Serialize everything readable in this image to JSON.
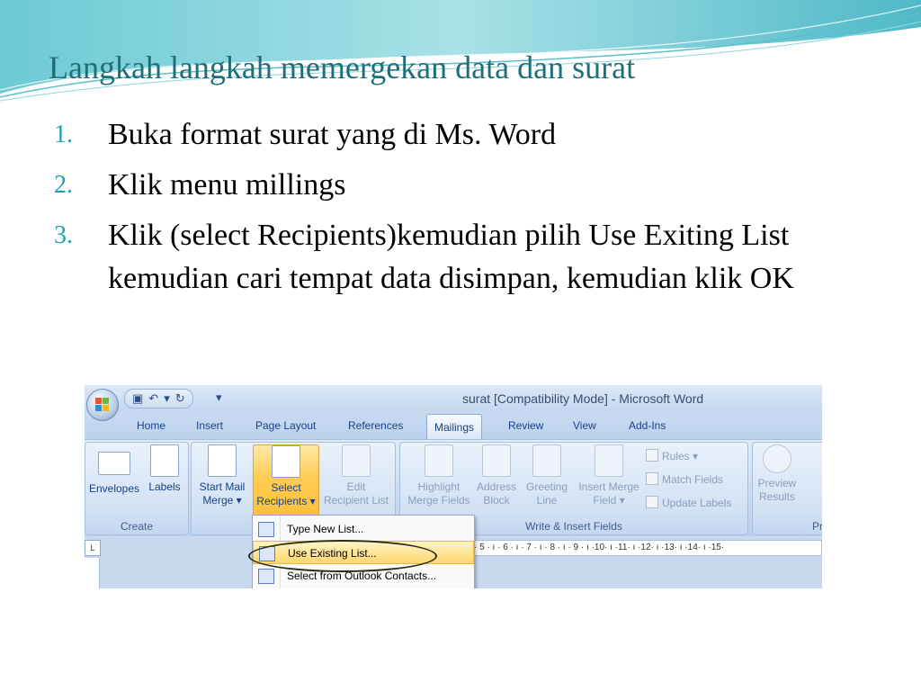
{
  "slide": {
    "title": "Langkah langkah memergekan data dan surat",
    "steps": [
      {
        "num": "1.",
        "text": "Buka format surat yang di Ms. Word"
      },
      {
        "num": "2.",
        "text": "Klik menu millings"
      },
      {
        "num": "3.",
        "text": "Klik (select Recipients)kemudian pilih Use Exiting List kemudian cari tempat data disimpan, kemudian klik OK"
      }
    ]
  },
  "word": {
    "window_title": "surat [Compatibility Mode] - Microsoft Word",
    "qat_dropdown": "▾",
    "tabs": [
      "Home",
      "Insert",
      "Page Layout",
      "References",
      "Mailings",
      "Review",
      "View",
      "Add-Ins"
    ],
    "active_tab": "Mailings",
    "groups": {
      "create": {
        "label": "Create",
        "envelopes": "Envelopes",
        "labels": "Labels"
      },
      "start": {
        "start_mail_merge": [
          "Start Mail",
          "Merge ▾"
        ],
        "select_recipients": [
          "Select",
          "Recipients ▾"
        ],
        "edit_recipient_list": [
          "Edit",
          "Recipient List"
        ]
      },
      "write_insert": {
        "label": "Write & Insert Fields",
        "highlight": [
          "Highlight",
          "Merge Fields"
        ],
        "address": [
          "Address",
          "Block"
        ],
        "greeting": [
          "Greeting",
          "Line"
        ],
        "insert_merge": [
          "Insert Merge",
          "Field ▾"
        ],
        "rules": "Rules ▾",
        "match_fields": "Match Fields",
        "update_labels": "Update Labels"
      },
      "preview": {
        "preview_results": [
          "Preview",
          "Results"
        ],
        "label_partial": "Pr"
      }
    },
    "ruler_text": "· 5 · ı · 6 · ı · 7 · ı · 8 · ı · 9 · ı ·10· ı ·11· ı ·12· ı ·13· ı ·14· ı ·15·",
    "ruler_tab": "L",
    "dropdown": [
      {
        "label": "Type New List...",
        "highlighted": false
      },
      {
        "label": "Use Existing List...",
        "highlighted": true
      },
      {
        "label": "Select from Outlook Contacts...",
        "highlighted": false
      }
    ]
  }
}
